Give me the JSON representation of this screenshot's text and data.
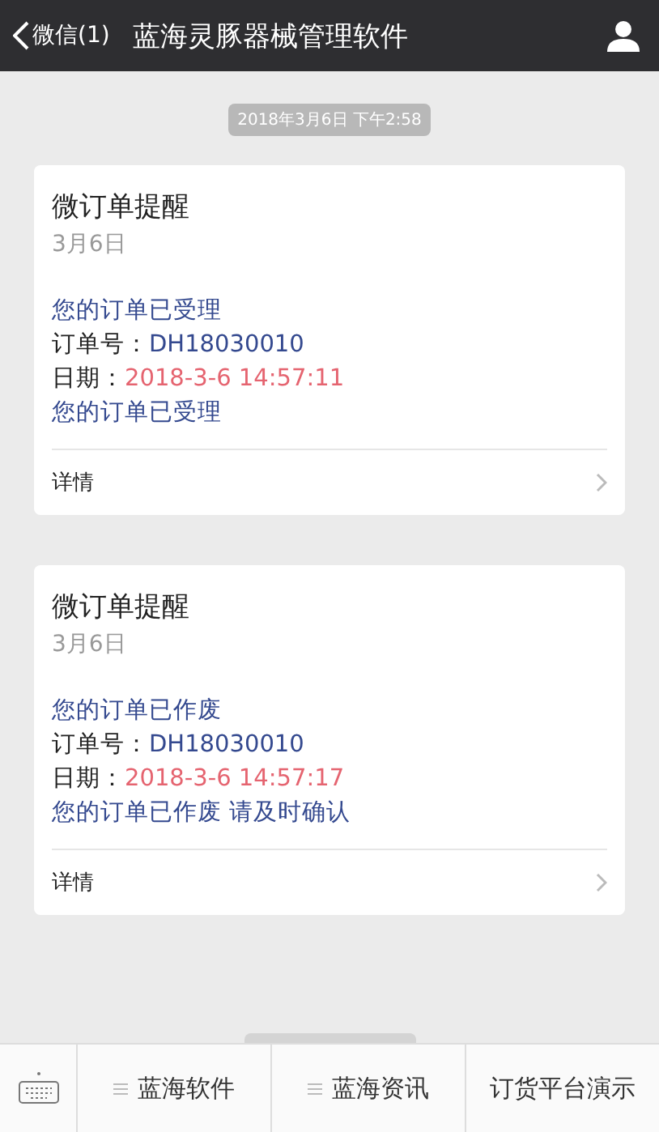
{
  "header": {
    "back_label": "微信(1)",
    "title": "蓝海灵豚器械管理软件"
  },
  "timestamp": "2018年3月6日 下午2:58",
  "cards": [
    {
      "title": "微订单提醒",
      "date": "3月6日",
      "lines": [
        {
          "value": "您的订单已受理",
          "color": "#34498f"
        },
        {
          "label": "订单号：",
          "value": "DH18030010",
          "color": "#34498f"
        },
        {
          "label": "日期：",
          "value": "2018-3-6 14:57:11",
          "color": "#e56470"
        },
        {
          "value": "您的订单已受理",
          "color": "#34498f"
        }
      ],
      "link": "详情"
    },
    {
      "title": "微订单提醒",
      "date": "3月6日",
      "lines": [
        {
          "value": "您的订单已作废",
          "color": "#34498f"
        },
        {
          "label": "订单号：",
          "value": "DH18030010",
          "color": "#34498f"
        },
        {
          "label": "日期：",
          "value": "2018-3-6 14:57:17",
          "color": "#e56470"
        },
        {
          "value": "您的订单已作废 请及时确认",
          "color": "#34498f"
        }
      ],
      "link": "详情"
    }
  ],
  "menu": [
    {
      "label": "蓝海软件",
      "submenu": true
    },
    {
      "label": "蓝海资讯",
      "submenu": true
    },
    {
      "label": "订货平台演示",
      "submenu": false
    }
  ]
}
